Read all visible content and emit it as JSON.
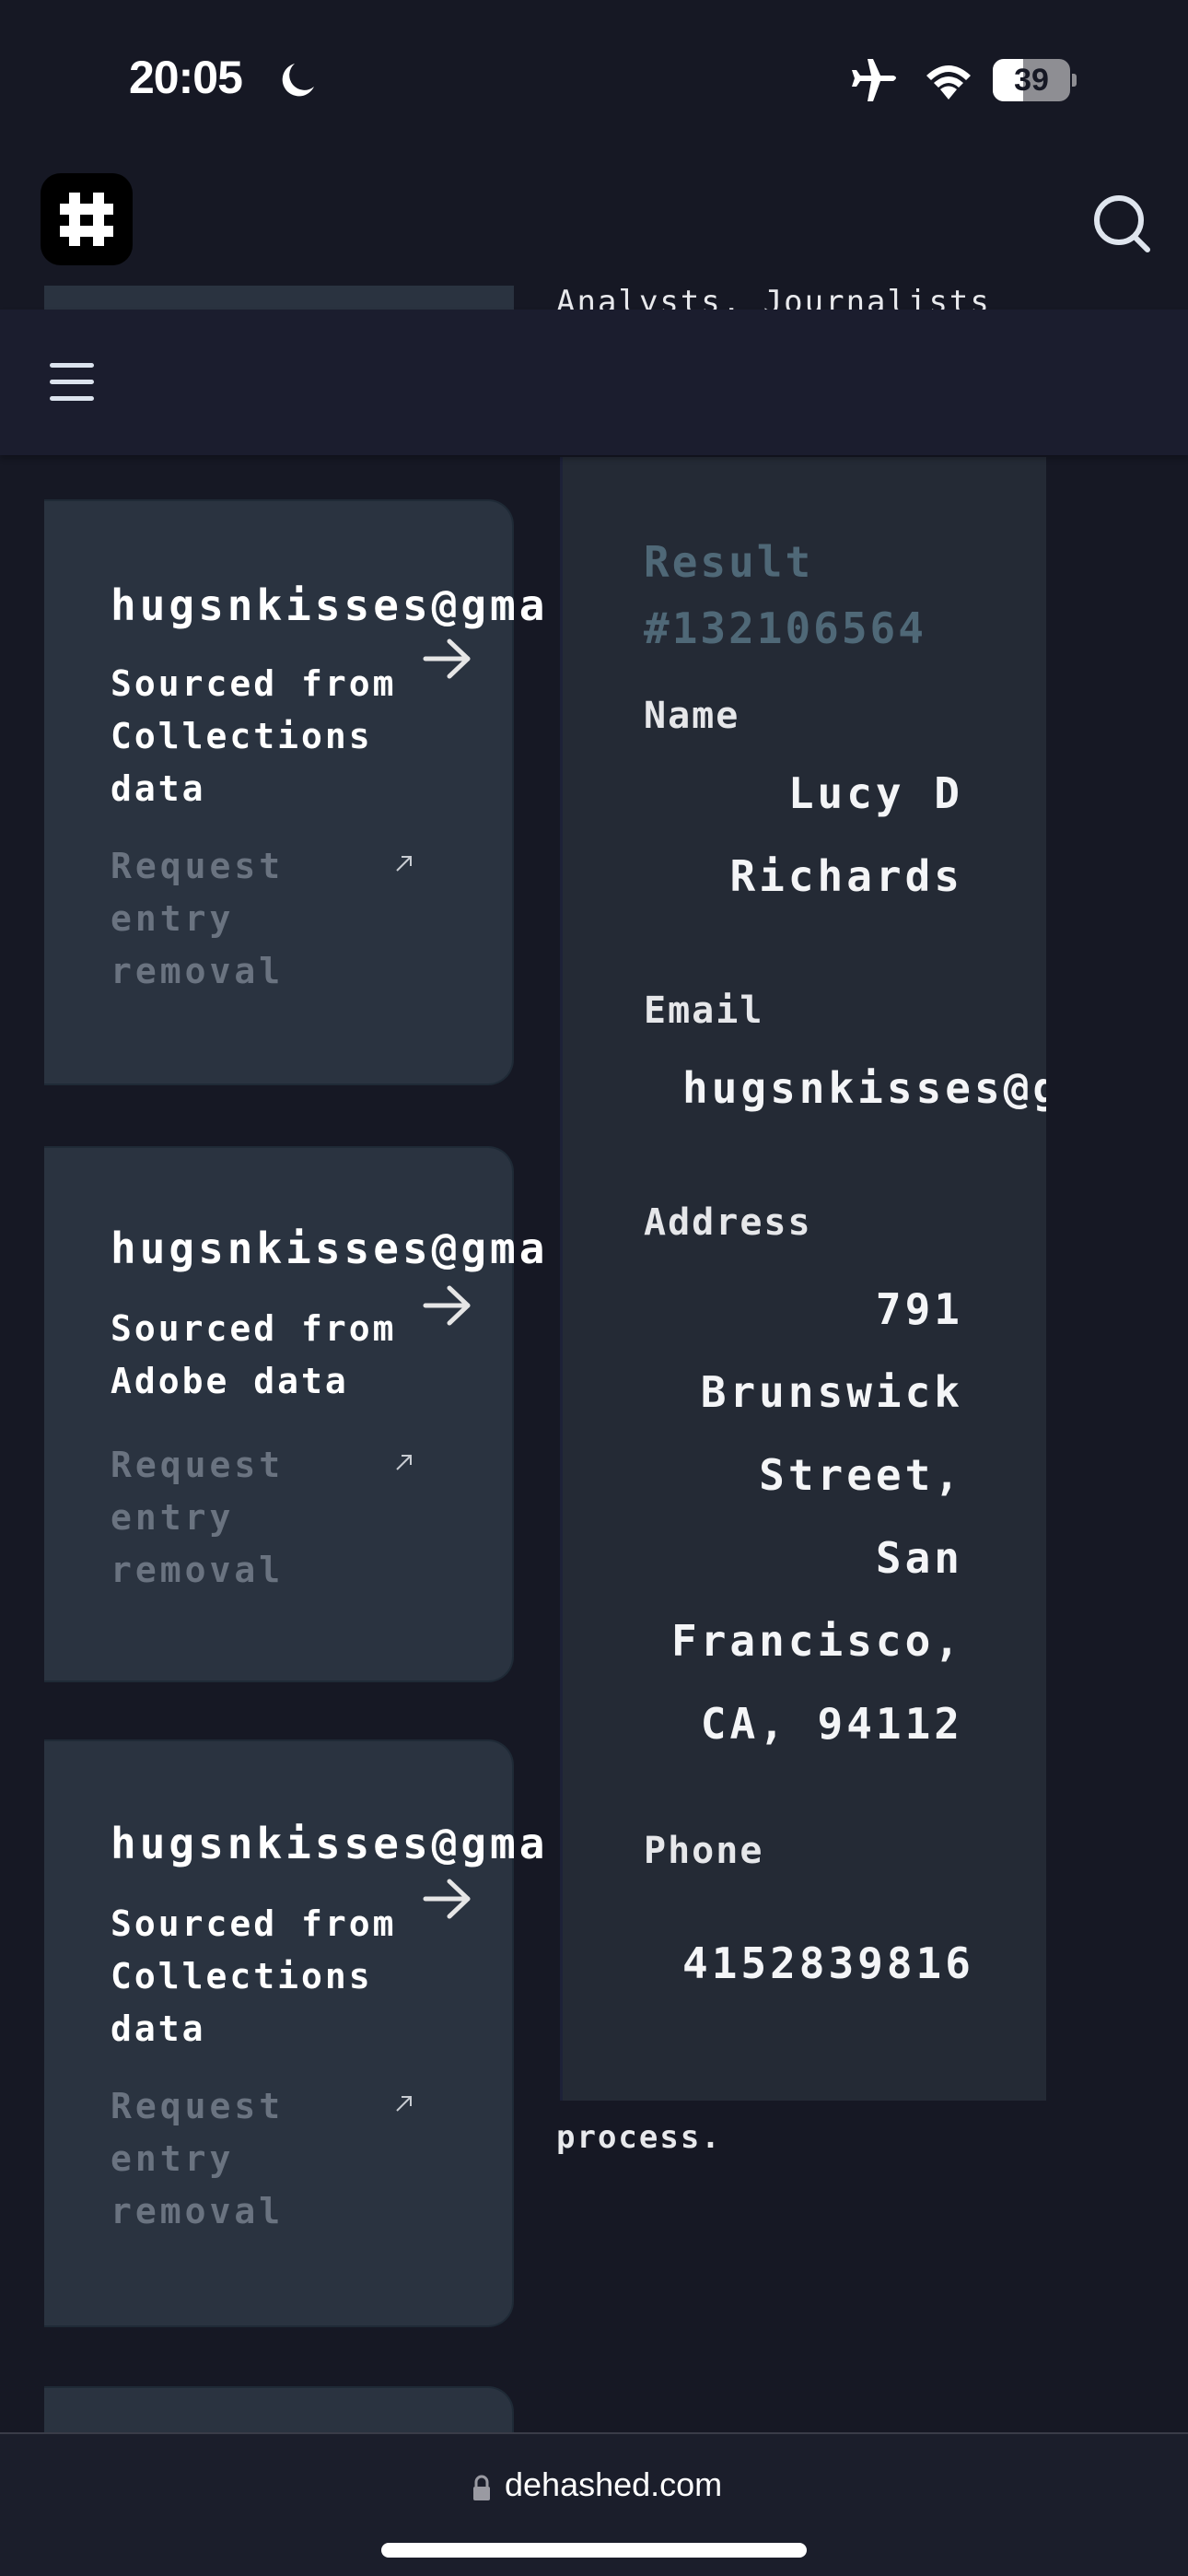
{
  "status_bar": {
    "time": "20:05",
    "focus_icon": "moon-icon",
    "airplane_icon": "airplane-icon",
    "wifi_icon": "wifi-icon",
    "battery_percent": 39,
    "battery_label": "39"
  },
  "header": {
    "logo_icon": "hash-icon",
    "search_icon": "search-icon"
  },
  "nav": {
    "menu_icon": "hamburger-menu-icon"
  },
  "background_text": {
    "partial_heading": "Analysts, Journalists",
    "trailing_text": "process."
  },
  "results": [
    {
      "email": "hugsnkisses@gma",
      "source": "Sourced from Collections data",
      "remove_label": "Request entry removal"
    },
    {
      "email": "hugsnkisses@gma",
      "source": "Sourced from Adobe data",
      "remove_label": "Request entry removal"
    },
    {
      "email": "hugsnkisses@gma",
      "source": "Sourced from Collections data",
      "remove_label": "Request entry removal"
    }
  ],
  "detail": {
    "title": "Result #132106564",
    "name_label": "Name",
    "name_value": "Lucy D\nRichards",
    "email_label": "Email",
    "email_value": "hugsnkisses@g",
    "address_label": "Address",
    "address_value": "791\nBrunswick\nStreet,\nSan\nFrancisco,\nCA, 94112",
    "phone_label": "Phone",
    "phone_value": "4152839816"
  },
  "browser": {
    "url": "dehashed.com",
    "lock_icon": "lock-icon"
  },
  "colors": {
    "background": "#161824",
    "nav_bar": "#1b1d2e",
    "card": "#2a3340",
    "detail_panel": "#242a35",
    "title_accent": "#4f6877",
    "muted_text": "#6a7380"
  }
}
